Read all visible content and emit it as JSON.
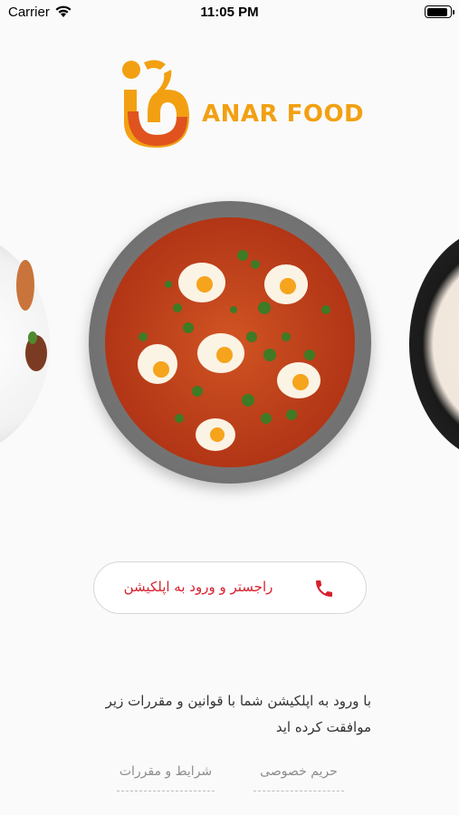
{
  "status_bar": {
    "carrier": "Carrier",
    "time": "11:05 PM",
    "battery_level": 0.95
  },
  "logo": {
    "text": "ANAR FOOD",
    "icon": "anar-food-logo-icon"
  },
  "carousel": {
    "items": [
      "dish-left-image",
      "dish-center-image",
      "dish-right-image"
    ]
  },
  "register_button": {
    "label": "راجستر و ورود به اپلکیشن",
    "icon": "phone-icon"
  },
  "terms": {
    "text": "با ورود به اپلکیشن شما با قوانین و مقررات زیر موافقت کرده اید"
  },
  "links": {
    "privacy": "حریم خصوصی",
    "terms": "شرایط و مقررات"
  },
  "colors": {
    "accent_red": "#d81f2d",
    "logo_orange": "#f2a012",
    "background": "#fafafa"
  }
}
